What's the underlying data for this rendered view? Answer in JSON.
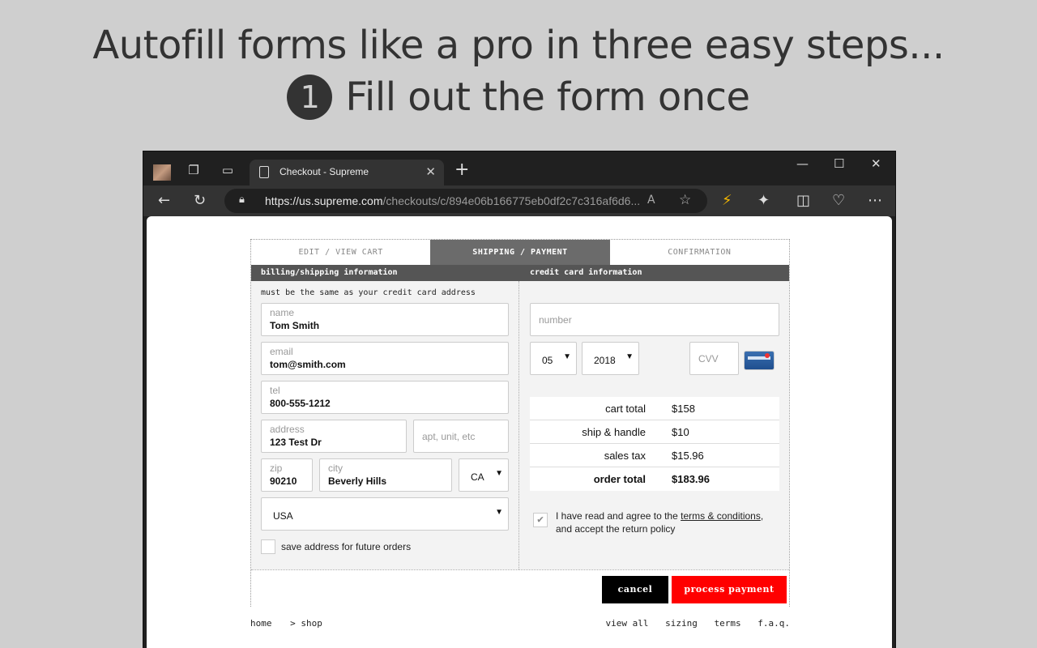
{
  "promo": {
    "line1": "Autofill forms like a pro in three easy steps...",
    "step_number": "1",
    "line2": "Fill out the form once"
  },
  "browser": {
    "tab_title": "Checkout - Supreme",
    "url_host": "https://us.supreme.com",
    "url_path": "/checkouts/c/894e06b166775eb0df2c7c316af6d6...",
    "icons": [
      "profile-icon",
      "workspaces-icon",
      "vertical-tabs-icon",
      "page-icon",
      "close-tab-icon",
      "new-tab-icon",
      "minimize-icon",
      "maximize-icon",
      "close-window-icon",
      "back-icon",
      "refresh-icon",
      "lock-icon",
      "read-aloud-icon",
      "favorite-star-icon",
      "extension-autofill-icon",
      "extensions-icon",
      "split-screen-icon",
      "browser-essentials-icon",
      "more-menu-icon"
    ]
  },
  "checkout": {
    "steps": [
      "EDIT / VIEW CART",
      "SHIPPING / PAYMENT",
      "CONFIRMATION"
    ],
    "active_step": "SHIPPING / PAYMENT",
    "billing_heading": "billing/shipping information",
    "card_heading": "credit card information",
    "billing_note": "must be the same as your credit card address",
    "fields": {
      "name": {
        "label": "name",
        "value": "Tom Smith"
      },
      "email": {
        "label": "email",
        "value": "tom@smith.com"
      },
      "tel": {
        "label": "tel",
        "value": "800-555-1212"
      },
      "address": {
        "label": "address",
        "value": "123 Test Dr"
      },
      "apt": {
        "placeholder": "apt, unit, etc"
      },
      "zip": {
        "label": "zip",
        "value": "90210"
      },
      "city": {
        "label": "city",
        "value": "Beverly Hills"
      },
      "state": {
        "value": "CA"
      },
      "country": {
        "value": "USA"
      }
    },
    "save_address_label": "save address for future orders",
    "save_address_checked": false,
    "card": {
      "number_placeholder": "number",
      "exp_month": "05",
      "exp_year": "2018",
      "cvv_placeholder": "CVV"
    },
    "totals": [
      {
        "label": "cart total",
        "value": "$158"
      },
      {
        "label": "ship & handle",
        "value": "$10"
      },
      {
        "label": "sales tax",
        "value": "$15.96"
      },
      {
        "label": "order total",
        "value": "$183.96"
      }
    ],
    "terms": {
      "prefix": "I have read and agree to the ",
      "link": "terms & conditions",
      "suffix": ", and accept the return policy",
      "checked": true
    },
    "cancel_label": "cancel",
    "pay_label": "process payment",
    "colors": {
      "pay": "#ff0000",
      "cancel": "#000000",
      "header": "#555555"
    }
  },
  "footer": {
    "home": "home",
    "shop": "> shop",
    "links": [
      "view all",
      "sizing",
      "terms",
      "f.a.q."
    ]
  }
}
